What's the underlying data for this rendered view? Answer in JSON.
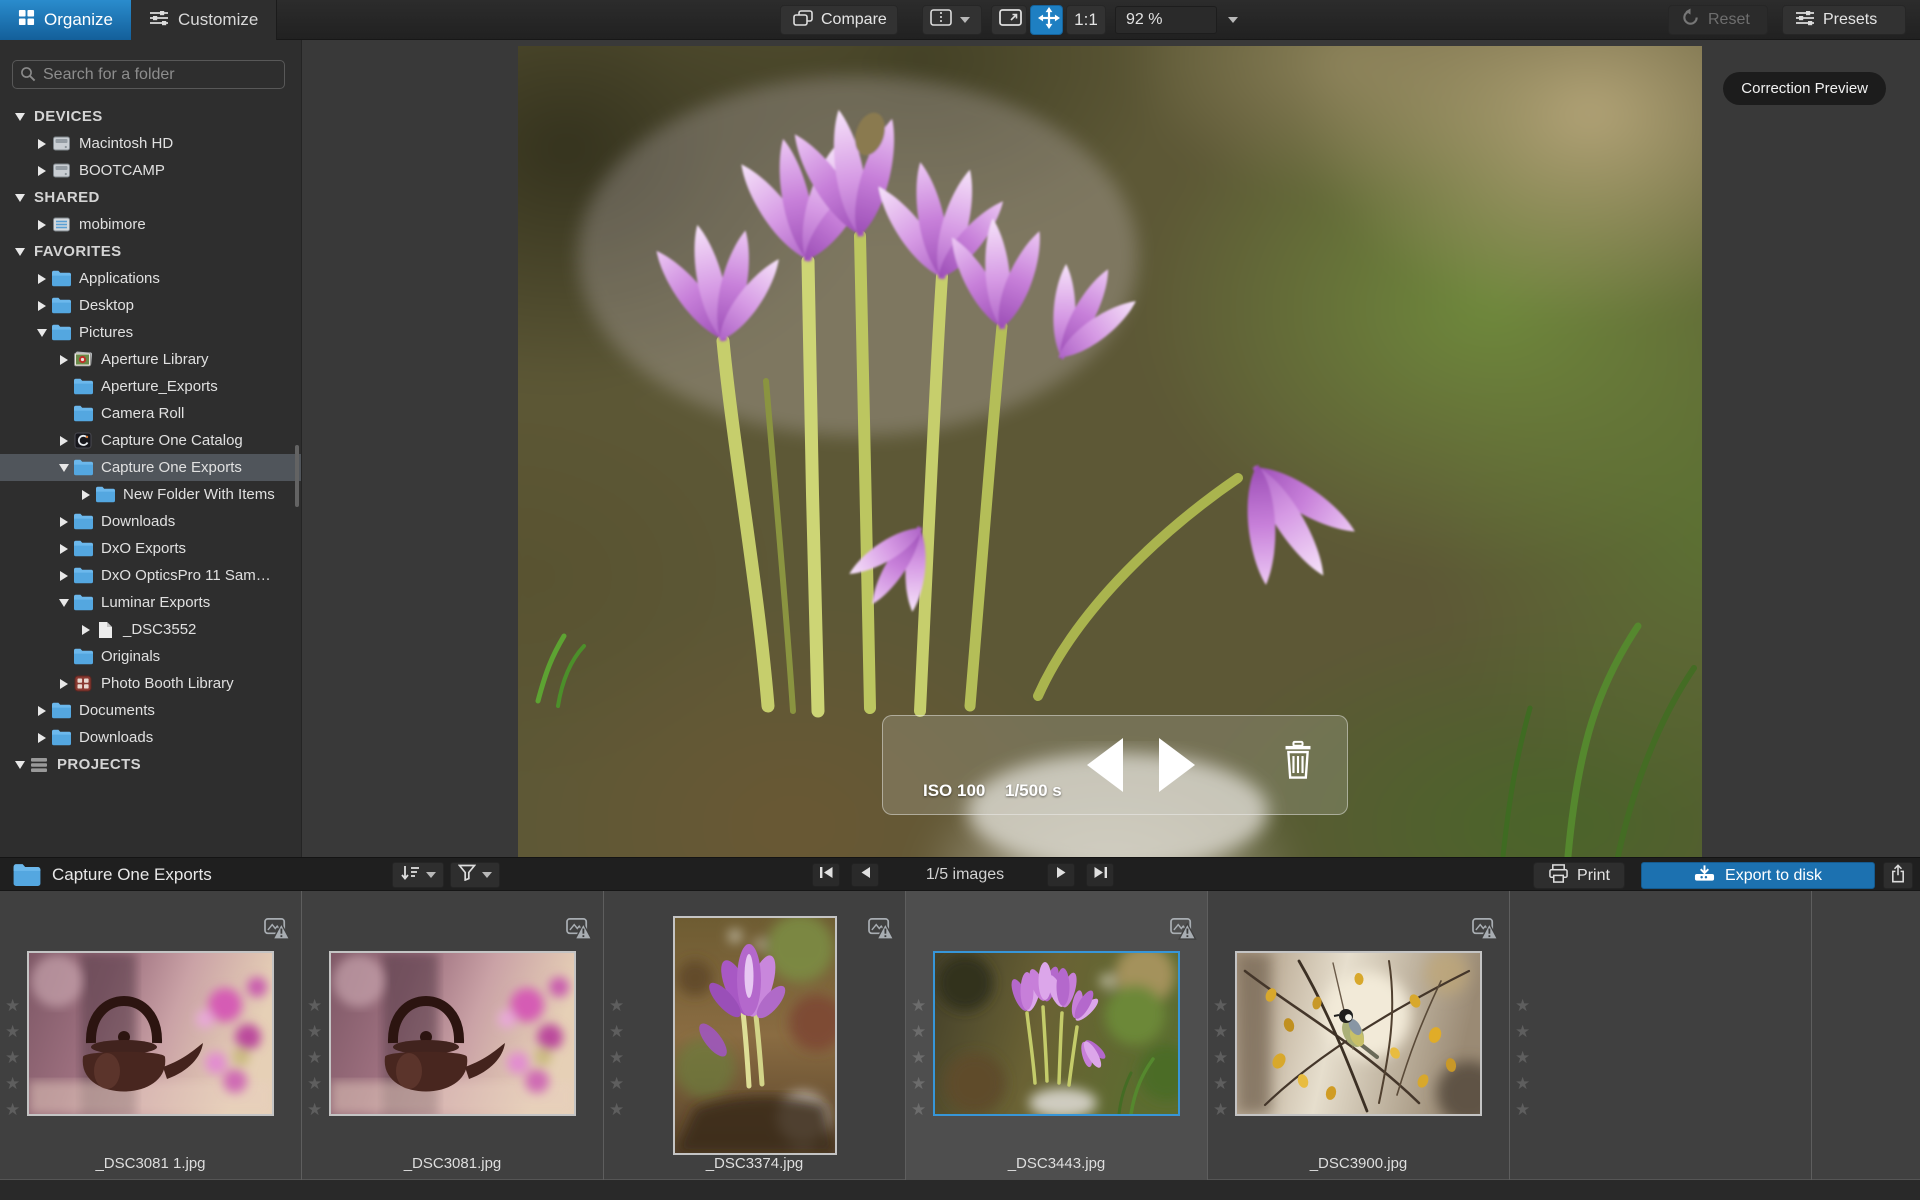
{
  "toolbar": {
    "tabs": [
      {
        "id": "organize",
        "label": "Organize",
        "icon": "grid-icon",
        "active": true
      },
      {
        "id": "customize",
        "label": "Customize",
        "icon": "sliders-icon",
        "active": false
      }
    ],
    "compare_label": "Compare",
    "compare_icon": "compare-icon",
    "split_view_icon": "split-view-icon",
    "fit_screen_icon": "fit-screen-icon",
    "pan_icon": "pan-icon",
    "one_to_one_label": "1:1",
    "zoom_value": "92 %",
    "reset_label": "Reset",
    "reset_icon": "reset-icon",
    "presets_label": "Presets",
    "presets_icon": "sliders-icon"
  },
  "sidebar": {
    "search_placeholder": "Search for a folder",
    "search_icon": "search-icon",
    "tree": [
      {
        "label": "DEVICES",
        "depth": 0,
        "arrow": "expanded",
        "icon": "",
        "section": true
      },
      {
        "label": "Macintosh HD",
        "depth": 1,
        "arrow": "collapsed",
        "icon": "drive-icon"
      },
      {
        "label": "BOOTCAMP",
        "depth": 1,
        "arrow": "collapsed",
        "icon": "drive-icon"
      },
      {
        "label": "SHARED",
        "depth": 0,
        "arrow": "expanded",
        "icon": "",
        "section": true
      },
      {
        "label": "mobimore",
        "depth": 1,
        "arrow": "collapsed",
        "icon": "server-icon"
      },
      {
        "label": "FAVORITES",
        "depth": 0,
        "arrow": "expanded",
        "icon": "",
        "section": true
      },
      {
        "label": "Applications",
        "depth": 1,
        "arrow": "collapsed",
        "icon": "folder-icon"
      },
      {
        "label": "Desktop",
        "depth": 1,
        "arrow": "collapsed",
        "icon": "folder-icon"
      },
      {
        "label": "Pictures",
        "depth": 1,
        "arrow": "expanded",
        "icon": "folder-icon"
      },
      {
        "label": "Aperture Library",
        "depth": 2,
        "arrow": "collapsed",
        "icon": "aperture-library-icon"
      },
      {
        "label": "Aperture_Exports",
        "depth": 2,
        "arrow": "none",
        "icon": "folder-icon"
      },
      {
        "label": "Camera Roll",
        "depth": 2,
        "arrow": "none",
        "icon": "folder-icon"
      },
      {
        "label": "Capture One Catalog",
        "depth": 2,
        "arrow": "collapsed",
        "icon": "capture-one-catalog-icon"
      },
      {
        "label": "Capture One Exports",
        "depth": 2,
        "arrow": "expanded",
        "icon": "folder-icon",
        "selected": true
      },
      {
        "label": "New Folder With Items",
        "depth": 3,
        "arrow": "collapsed",
        "icon": "folder-icon"
      },
      {
        "label": "Downloads",
        "depth": 2,
        "arrow": "collapsed",
        "icon": "folder-icon"
      },
      {
        "label": "DxO Exports",
        "depth": 2,
        "arrow": "collapsed",
        "icon": "folder-icon"
      },
      {
        "label": "DxO OpticsPro 11 Sam…",
        "depth": 2,
        "arrow": "collapsed",
        "icon": "folder-icon"
      },
      {
        "label": "Luminar Exports",
        "depth": 2,
        "arrow": "expanded",
        "icon": "folder-icon"
      },
      {
        "label": "_DSC3552",
        "depth": 3,
        "arrow": "collapsed",
        "icon": "file-icon"
      },
      {
        "label": "Originals",
        "depth": 2,
        "arrow": "none",
        "icon": "folder-icon"
      },
      {
        "label": "Photo Booth Library",
        "depth": 2,
        "arrow": "collapsed",
        "icon": "photo-booth-icon"
      },
      {
        "label": "Documents",
        "depth": 1,
        "arrow": "collapsed",
        "icon": "folder-icon"
      },
      {
        "label": "Downloads",
        "depth": 1,
        "arrow": "collapsed",
        "icon": "folder-icon"
      },
      {
        "label": "PROJECTS",
        "depth": 0,
        "arrow": "expanded",
        "icon": "projects-icon",
        "section": true
      }
    ]
  },
  "viewer": {
    "correction_preview_label": "Correction Preview",
    "exif": {
      "iso": "ISO 100",
      "shutter": "1/500 s"
    },
    "prev_icon": "prev-arrow-icon",
    "next_icon": "next-arrow-icon",
    "delete_icon": "trash-icon"
  },
  "filmstrip": {
    "folder_icon": "folder-icon",
    "folder_label": "Capture One Exports",
    "sort_icon": "sort-icon",
    "filter_icon": "filter-icon",
    "position_label": "1/5 images",
    "first_icon": "first-icon",
    "prev_icon": "prev-icon",
    "next_icon": "next-icon",
    "last_icon": "last-icon",
    "print_label": "Print",
    "print_icon": "print-icon",
    "export_label": "Export to disk",
    "export_icon": "export-disk-icon",
    "share_icon": "share-icon",
    "rating_stars_per_item": 5,
    "items": [
      {
        "filename": "_DSC3081 1.jpg",
        "selected": false,
        "orientation": "landscape",
        "art": "teapot",
        "badge": "no-lens-module-warning-icon",
        "rating": 0
      },
      {
        "filename": "_DSC3081.jpg",
        "selected": false,
        "orientation": "landscape",
        "art": "teapot",
        "badge": "no-lens-module-warning-icon",
        "rating": 0
      },
      {
        "filename": "_DSC3374.jpg",
        "selected": false,
        "orientation": "portrait",
        "art": "crocus-portrait",
        "badge": "no-lens-module-warning-icon",
        "rating": 0
      },
      {
        "filename": "_DSC3443.jpg",
        "selected": true,
        "orientation": "landscape",
        "art": "crocus-landscape",
        "badge": "no-lens-module-warning-icon",
        "rating": 0
      },
      {
        "filename": "_DSC3900.jpg",
        "selected": false,
        "orientation": "landscape",
        "art": "bird-autumn",
        "badge": "no-lens-module-warning-icon",
        "rating": 0
      }
    ]
  },
  "colors": {
    "tab_active_blue": "#1b79bb",
    "pan_tool_blue": "#1e7fc2",
    "export_button_blue": "#1c71b0",
    "folder_blue": "#54a7e0",
    "selected_row_gray": "#50555b",
    "selected_thumb_border": "#3796d8"
  }
}
